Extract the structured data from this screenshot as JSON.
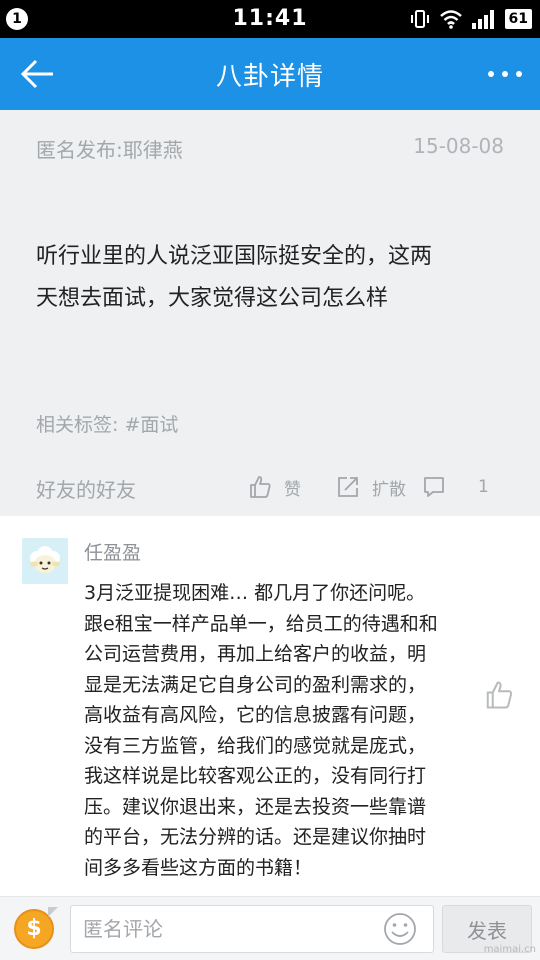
{
  "status_bar": {
    "notification_count": "1",
    "time": "11:41",
    "battery": "61",
    "icons": [
      "vibrate-icon",
      "wifi-icon",
      "signal-icon",
      "battery-icon"
    ]
  },
  "header": {
    "title": "八卦详情",
    "back_icon": "arrow-left-icon",
    "more_icon": "more-dots-icon",
    "background_color": "#1c91e6"
  },
  "post": {
    "author": "匿名发布:耶律燕",
    "date": "15-08-08",
    "body_lines": [
      "听行业里的人说泛亚国际挺安全的，这两",
      "天想去面试，大家觉得这公司怎么样"
    ],
    "tags_label": "相关标签: ",
    "tag": "#面试",
    "relation": "好友的好友",
    "actions": {
      "like_label": "赞",
      "share_label": "扩散",
      "comment_count": "1"
    }
  },
  "comment": {
    "author": "任盈盈",
    "lines": [
      "3月泛亚提现困难… 都几月了你还问呢。",
      "跟e租宝一样产品单一，给员工的待遇和和",
      "公司运营费用，再加上给客户的收益，明",
      "显是无法满足它自身公司的盈利需求的，",
      "高收益有高风险，它的信息披露有问题，",
      "没有三方监管，给我们的感觉就是庞式，",
      "我这样说是比较客观公正的，没有同行打",
      "压。建议你退出来，还是去投资一些靠谱",
      "的平台，无法分辨的话。还是建议你抽时",
      "间多多看些这方面的书籍！"
    ]
  },
  "input_bar": {
    "coin_symbol": "$",
    "placeholder": "匿名评论",
    "send_label": "发表"
  },
  "watermark": "maimai.cn"
}
